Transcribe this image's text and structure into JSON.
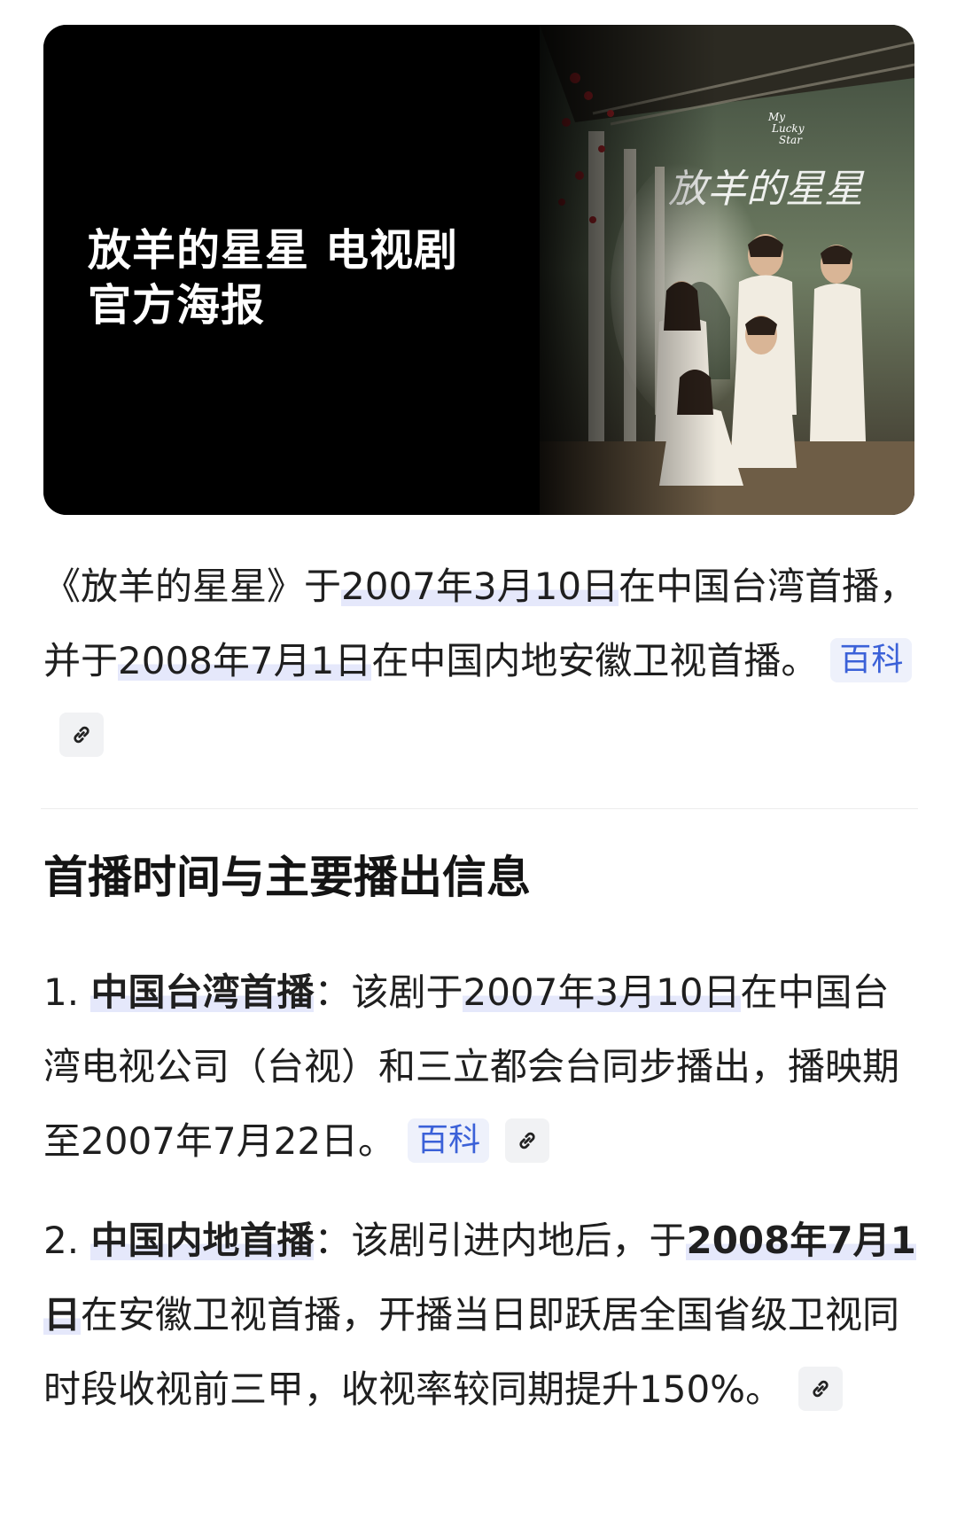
{
  "poster": {
    "title_line1": "放羊的星星 电视剧",
    "title_line2": "官方海报",
    "art_title": "放羊的星星",
    "art_subtitle_1": "My",
    "art_subtitle_2": "Lucky",
    "art_subtitle_3": "Star"
  },
  "intro": {
    "open_quote": "《放羊的星星》于",
    "date1": "2007年3月10日",
    "mid1": "在中国台湾首播，并于",
    "date2": "2008年7月1日",
    "tail": "在中国内地安徽卫视首播。",
    "source_badge": "百科"
  },
  "section": {
    "title": "首播时间与主要播出信息"
  },
  "items": [
    {
      "number": "1.",
      "heading": "中国台湾首播",
      "colon": "：",
      "lead": "该剧于",
      "date": "2007年3月10日",
      "rest": "在中国台湾电视公司（台视）和三立都会台同步播出，播映期至2007年7月22日。",
      "source_badge": "百科"
    },
    {
      "number": "2.",
      "heading": "中国内地首播",
      "colon": "：",
      "lead": "该剧引进内地后，于",
      "date": "2008年7月1日",
      "rest": "在安徽卫视首播，开播当日即跃居全国省级卫视同时段收视前三甲，收视率较同期提升150%。"
    }
  ],
  "colors": {
    "highlight": "#e5e8fb",
    "badge_text": "#3b61d8",
    "badge_bg": "#eef1fb"
  }
}
